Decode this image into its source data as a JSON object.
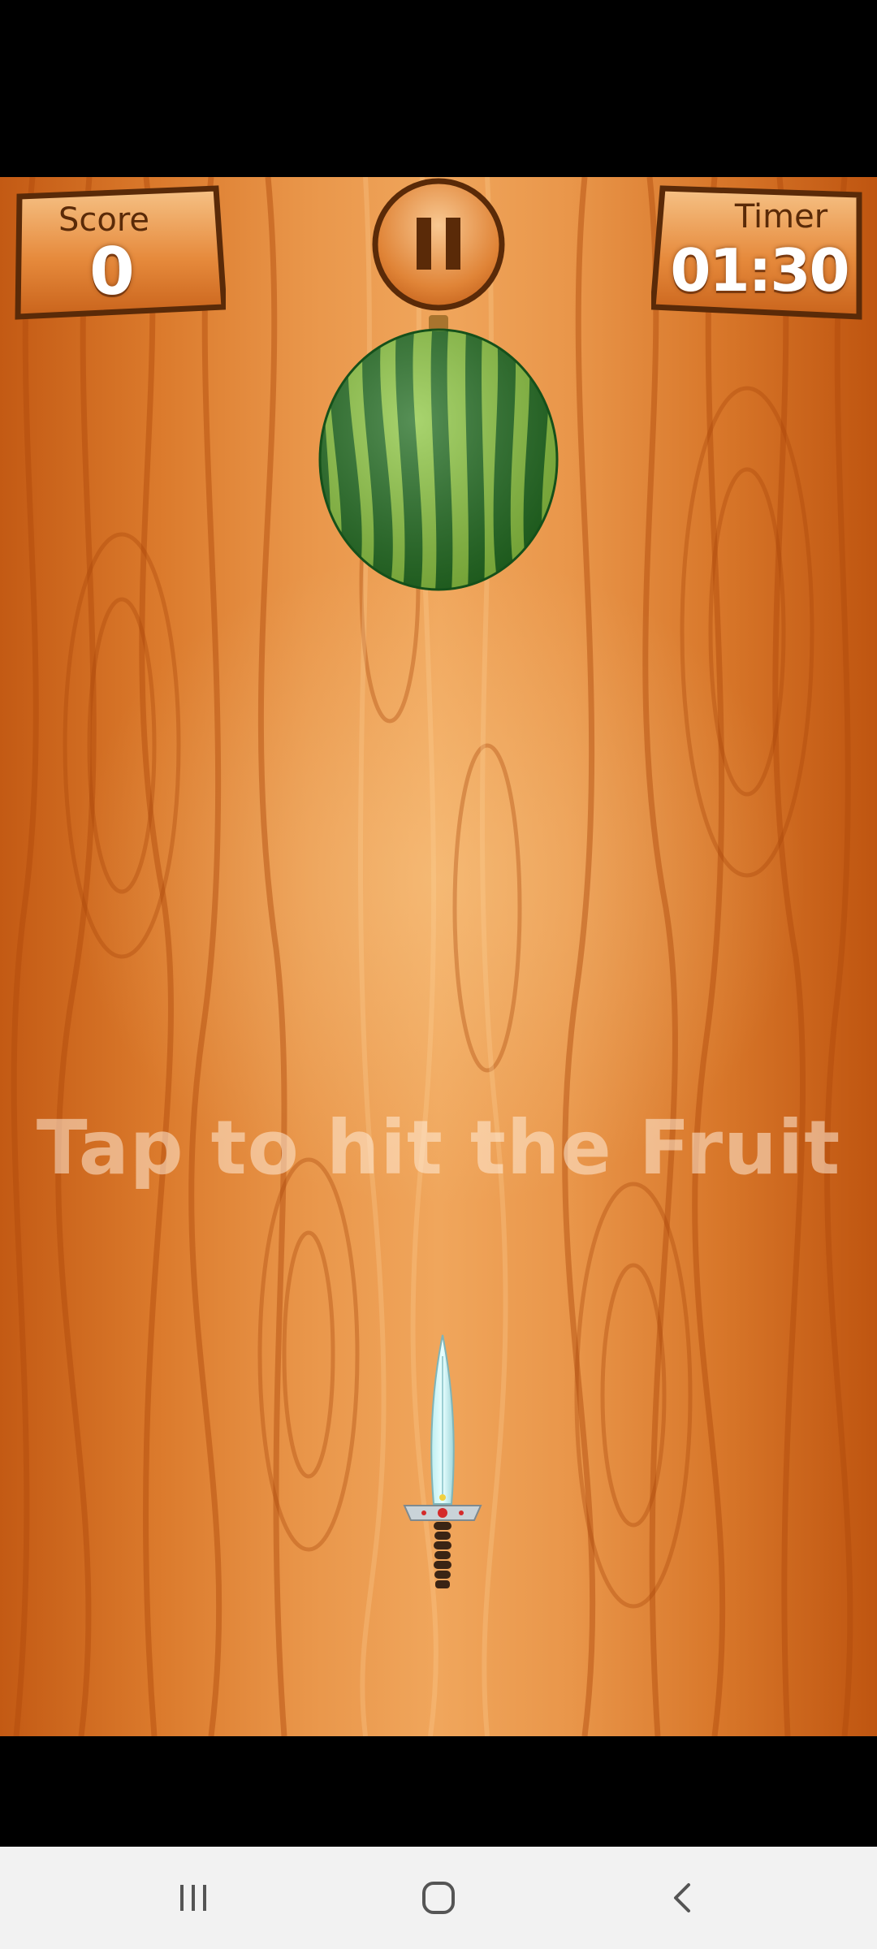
{
  "hud": {
    "score_label": "Score",
    "score_value": "0",
    "timer_label": "Timer",
    "timer_value": "01:30"
  },
  "pause": {
    "icon": "pause-icon"
  },
  "fruit": {
    "icon": "watermelon-icon"
  },
  "hint": {
    "text": "Tap to hit the Fruit"
  },
  "player": {
    "icon": "knife-icon"
  },
  "nav": {
    "recent_icon": "recent-apps-icon",
    "home_icon": "home-icon",
    "back_icon": "back-icon"
  },
  "colors": {
    "wood_light": "#f0a65c",
    "wood_dark": "#c35a14",
    "panel_border": "#5a2a08",
    "watermelon_dark": "#1f6b1e",
    "watermelon_light": "#8cc63f"
  }
}
